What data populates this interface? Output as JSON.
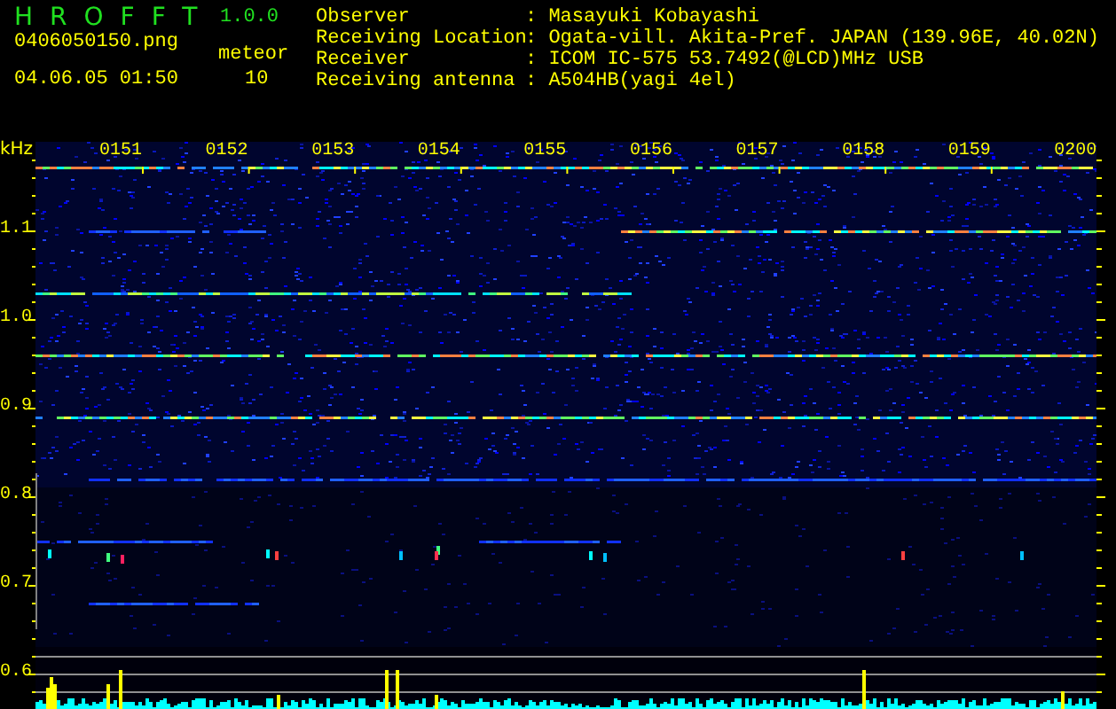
{
  "app": {
    "name": "HROFFT",
    "version": "1.0.0"
  },
  "file": {
    "name": "0406050150.png",
    "timestamp": "04.06.05 01:50"
  },
  "meteor": {
    "label": "meteor",
    "count": "10"
  },
  "info": [
    {
      "label": "Observer",
      "value": ": Masayuki Kobayashi"
    },
    {
      "label": "Receiving Location",
      "value": ": Ogata-vill. Akita-Pref. JAPAN (139.96E, 40.02N)"
    },
    {
      "label": "Receiver",
      "value": ": ICOM IC-575 53.7492(@LCD)MHz USB"
    },
    {
      "label": "Receiving antenna",
      "value": ": A504HB(yagi 4el)"
    }
  ],
  "spectrogram": {
    "unit": "kHz",
    "frequency_labels": [
      "1.1",
      "1.0",
      "0.9",
      "0.8",
      "0.7",
      "0.6"
    ],
    "time_labels": [
      "0151",
      "0152",
      "0153",
      "0154",
      "0155",
      "0156",
      "0157",
      "0158",
      "0159",
      "0200"
    ]
  }
}
